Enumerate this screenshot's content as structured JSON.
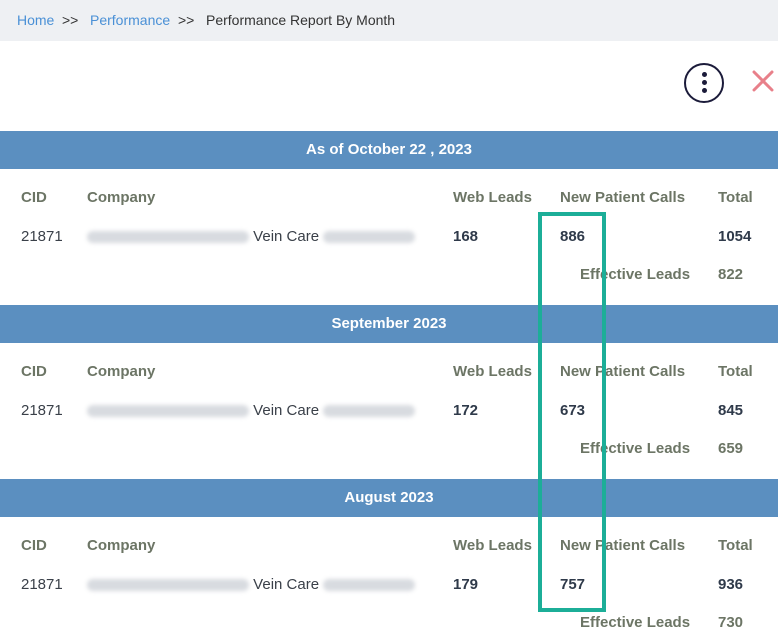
{
  "breadcrumb": {
    "home": "Home",
    "sep": ">>",
    "performance": "Performance",
    "current": "Performance Report By Month"
  },
  "columns": {
    "cid": "CID",
    "company": "Company",
    "web_leads": "Web Leads",
    "new_patient_calls": "New Patient Calls",
    "total": "Total",
    "effective_leads": "Effective Leads"
  },
  "sections": [
    {
      "title": "As of October 22 , 2023",
      "row": {
        "cid": "21871",
        "company_visible": "Vein Care",
        "web_leads": "168",
        "new_patient_calls": "886",
        "total": "1054",
        "effective_leads": "822"
      }
    },
    {
      "title": "September 2023",
      "row": {
        "cid": "21871",
        "company_visible": "Vein Care",
        "web_leads": "172",
        "new_patient_calls": "673",
        "total": "845",
        "effective_leads": "659"
      }
    },
    {
      "title": "August 2023",
      "row": {
        "cid": "21871",
        "company_visible": "Vein Care",
        "web_leads": "179",
        "new_patient_calls": "757",
        "total": "936",
        "effective_leads": "730"
      }
    }
  ],
  "colors": {
    "header_bg": "#5b8fc0",
    "link": "#4a90d6",
    "highlight": "#1cae98",
    "close": "#e8808a"
  },
  "icons": {
    "more": "vertical-ellipsis-icon",
    "close": "close-icon"
  }
}
